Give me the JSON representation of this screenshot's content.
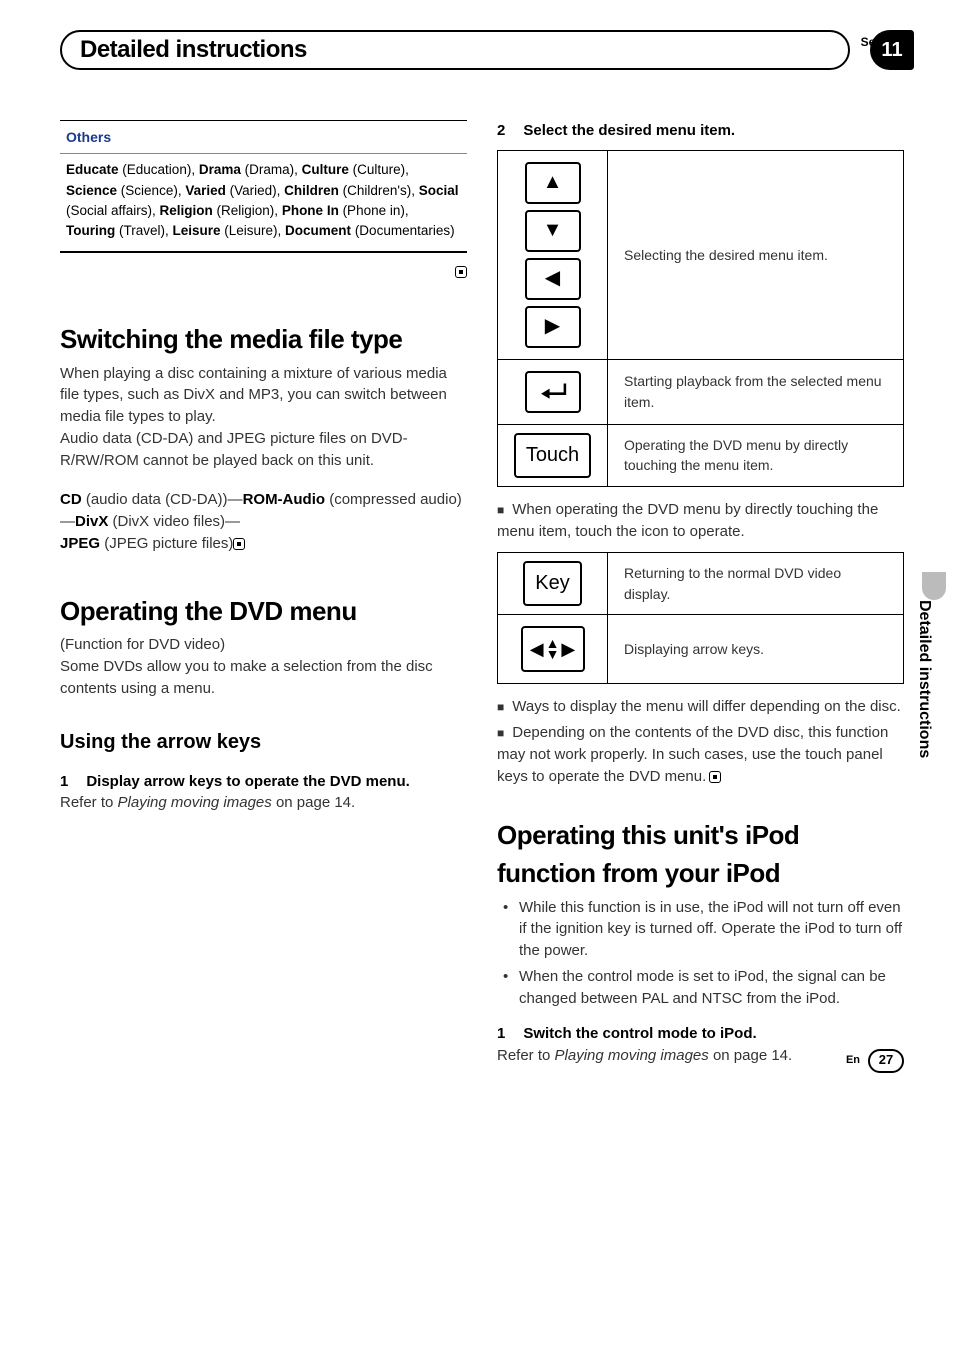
{
  "header": {
    "section_label": "Section",
    "title": "Detailed instructions",
    "section_number": "11"
  },
  "side_tab": "Detailed instructions",
  "footer": {
    "lang": "En",
    "page": "27"
  },
  "left": {
    "others_header": "Others",
    "others_body_parts": {
      "educate_b": "Educate",
      "educate_p": " (Education), ",
      "drama_b": "Drama",
      "drama_p": " (Drama), ",
      "culture_b": "Culture",
      "culture_p": " (Culture), ",
      "science_b": "Science",
      "science_p": " (Science), ",
      "varied_b": "Varied",
      "varied_p": " (Varied), ",
      "children_b": "Children",
      "children_p": " (Children's), ",
      "social_b": "Social",
      "social_p": " (Social affairs), ",
      "religion_b": "Religion",
      "religion_p": " (Religion), ",
      "phone_b": "Phone In",
      "phone_p": " (Phone in), ",
      "touring_b": "Touring",
      "touring_p": " (Travel), ",
      "leisure_b": "Leisure",
      "leisure_p": " (Leisure), ",
      "document_b": "Document",
      "document_p": " (Documentaries)"
    },
    "switching_h": "Switching the media file type",
    "switching_p1": "When playing a disc containing a mixture of various media file types, such as DivX and MP3, you can switch between media file types to play.",
    "switching_p2": "Audio data (CD-DA) and JPEG picture files on DVD-R/RW/ROM cannot be played back on this unit.",
    "chain": {
      "cd_b": "CD",
      "cd_p": " (audio data (CD-DA))—",
      "rom_b": "ROM-Audio",
      "rom_p": " (compressed audio)—",
      "divx_b": "DivX",
      "divx_p": " (DivX video files)—",
      "jpeg_b": "JPEG",
      "jpeg_p": " (JPEG picture files)"
    },
    "operating_h": "Operating the DVD menu",
    "operating_p1": "(Function for DVD video)",
    "operating_p2": "Some DVDs allow you to make a selection from the disc contents using a menu.",
    "arrow_h": "Using the arrow keys",
    "step1_num": "1",
    "step1_text": "Display arrow keys to operate the DVD menu.",
    "step1_ref_a": "Refer to ",
    "step1_ref_i": "Playing moving images",
    "step1_ref_b": " on page 14."
  },
  "right": {
    "step2_num": "2",
    "step2_text": "Select the desired menu item.",
    "table1": {
      "row1_desc": "Selecting the desired menu item.",
      "row2_desc": "Starting playback from the selected menu item.",
      "row3_label": "Touch",
      "row3_desc": "Operating the DVD menu by directly touching the menu item."
    },
    "note1": "When operating the DVD menu by directly touching the menu item, touch the icon to operate.",
    "table2": {
      "row1_label": "Key",
      "row1_desc": "Returning to the normal DVD video display.",
      "row2_desc": "Displaying arrow keys."
    },
    "note2": "Ways to display the menu will differ depending on the disc.",
    "note3_a": "Depending on the contents of the DVD disc, this function may not work properly. In such cases, use the touch panel keys to operate the DVD menu.",
    "ipod_h": "Operating this unit's iPod function from your iPod",
    "ipod_li1": "While this function is in use, the iPod will not turn off even if the ignition key is turned off. Operate the iPod to turn off the power.",
    "ipod_li2": "When the control mode is set to iPod, the signal can be changed between PAL and NTSC from the iPod.",
    "step_ipod_num": "1",
    "step_ipod_text": "Switch the control mode to iPod.",
    "step_ipod_ref_a": "Refer to ",
    "step_ipod_ref_i": "Playing moving images",
    "step_ipod_ref_b": " on page 14."
  }
}
